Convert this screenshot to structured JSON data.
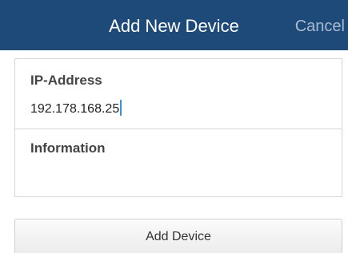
{
  "header": {
    "title": "Add New Device",
    "cancel_label": "Cancel"
  },
  "form": {
    "ip_address": {
      "label": "IP-Address",
      "value": "192.178.168.25"
    },
    "information": {
      "label": "Information",
      "value": ""
    }
  },
  "actions": {
    "add_device_label": "Add Device"
  },
  "colors": {
    "header_background": "#1e4a7a",
    "header_text": "#ffffff",
    "cancel_text": "#a9bbcf",
    "caret": "#3b8fe0"
  }
}
